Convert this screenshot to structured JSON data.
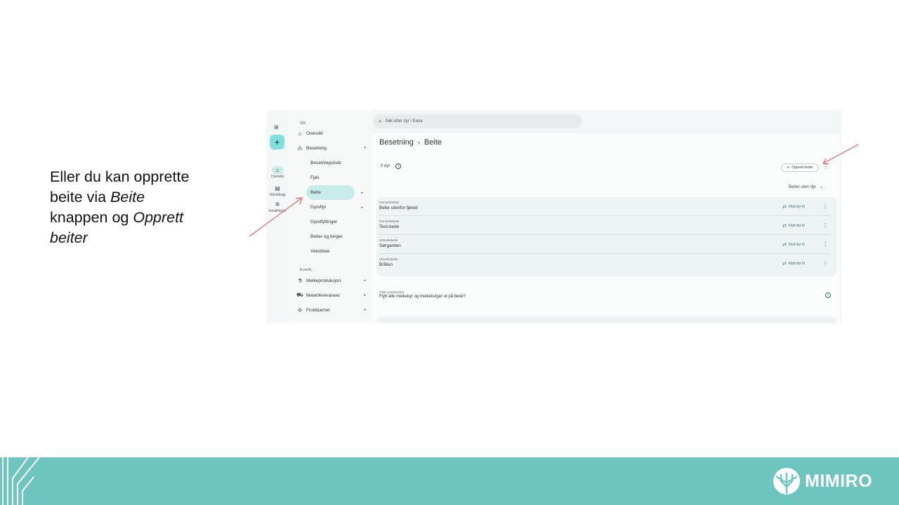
{
  "instruction": {
    "line1": "Eller du kan opprette",
    "line2_prefix": "beite via ",
    "line2_em": "Beite",
    "line3_prefix": "knappen og ",
    "line3_em": "Opprett",
    "line4_em": "beiter"
  },
  "app": {
    "search": {
      "placeholder": "Søk etter dyr i Eana"
    },
    "rail": {
      "add_label": "+",
      "items": [
        {
          "label": "Oversikt",
          "icon": "home-icon"
        },
        {
          "label": "Gårdslogg",
          "icon": "logbook-icon"
        },
        {
          "label": "Innstillinger",
          "icon": "settings-icon"
        }
      ]
    },
    "sidebar": {
      "section_360": "360",
      "overview": "Oversikt",
      "herd": "Besetning",
      "herd_sub": [
        "Besetningsliste",
        "Fjøs",
        "Beite",
        "Dyreflyt",
        "Dyreflyttinger",
        "Beiter og binger",
        "Vekstliste"
      ],
      "section_kumelk": "Kumelk",
      "milk_production": "Melkeproduksjon",
      "dairy_deliveries": "Meierileveranser",
      "fertility": "Fruktbarhet"
    },
    "breadcrumb": {
      "parent": "Besetning",
      "current": "Beite"
    },
    "count": "0 dyr",
    "create_button": "Opprett beiter",
    "filter": "Beiter uten dyr",
    "pastures": [
      {
        "type": "Innmarksbeite",
        "name": "Beite utenfor fjøset",
        "action": "Flytt dyr til"
      },
      {
        "type": "Innmarksbeite",
        "name": "Test-beite",
        "action": "Flytt dyr til"
      },
      {
        "type": "Utmarksbeite",
        "name": "Sørgarden",
        "action": "Flytt dyr til"
      },
      {
        "type": "Utmarksbeite",
        "name": "Bråten",
        "action": "Flytt dyr til"
      }
    ],
    "tine": {
      "label": "TINE produsenter",
      "question": "Flytt alle melkekyr og melkekviger ut på beite?"
    }
  },
  "footer": {
    "brand": "MIMIRO",
    "background": "#6ec5bf"
  },
  "colors": {
    "accent": "#7fe0de",
    "selected": "#c9ebea",
    "arrow": "#e07b78"
  }
}
